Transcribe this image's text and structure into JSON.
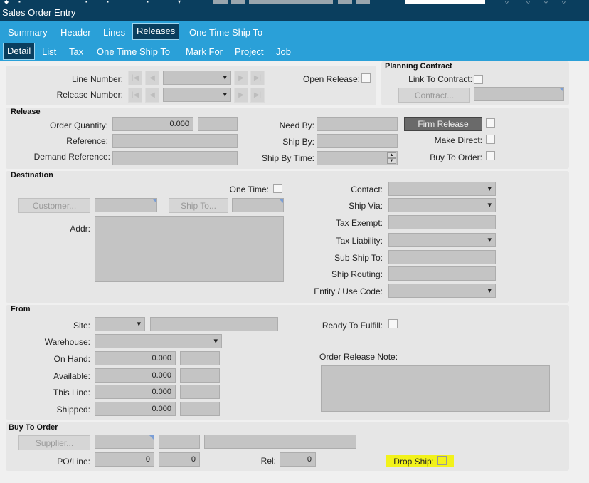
{
  "window": {
    "title": "Sales Order Entry"
  },
  "tabs_main": [
    "Summary",
    "Header",
    "Lines",
    "Releases",
    "One Time Ship To"
  ],
  "tabs_sub": [
    "Detail",
    "List",
    "Tax",
    "One Time Ship To",
    "Mark For",
    "Project",
    "Job"
  ],
  "top": {
    "line_number_label": "Line Number:",
    "release_number_label": "Release Number:",
    "open_release_label": "Open Release:",
    "planning_contract_title": "Planning Contract",
    "link_to_contract_label": "Link To Contract:",
    "contract_button": "Contract..."
  },
  "release": {
    "title": "Release",
    "order_quantity_label": "Order Quantity:",
    "order_quantity_value": "0.000",
    "reference_label": "Reference:",
    "demand_reference_label": "Demand Reference:",
    "need_by_label": "Need By:",
    "ship_by_label": "Ship By:",
    "ship_by_time_label": "Ship By Time:",
    "firm_release_button": "Firm Release",
    "make_direct_label": "Make Direct:",
    "buy_to_order_label": "Buy To Order:"
  },
  "destination": {
    "title": "Destination",
    "one_time_label": "One Time:",
    "customer_button": "Customer...",
    "ship_to_button": "Ship To...",
    "addr_label": "Addr:",
    "contact_label": "Contact:",
    "ship_via_label": "Ship Via:",
    "tax_exempt_label": "Tax Exempt:",
    "tax_liability_label": "Tax Liability:",
    "sub_ship_to_label": "Sub Ship To:",
    "ship_routing_label": "Ship Routing:",
    "entity_use_code_label": "Entity / Use Code:"
  },
  "from": {
    "title": "From",
    "site_label": "Site:",
    "warehouse_label": "Warehouse:",
    "on_hand_label": "On Hand:",
    "on_hand_value": "0.000",
    "available_label": "Available:",
    "available_value": "0.000",
    "this_line_label": "This Line:",
    "this_line_value": "0.000",
    "shipped_label": "Shipped:",
    "shipped_value": "0.000",
    "ready_to_fulfill_label": "Ready To Fulfill:",
    "order_release_note_label": "Order Release Note:"
  },
  "buy_to_order": {
    "title": "Buy To Order",
    "supplier_button": "Supplier...",
    "po_line_label": "PO/Line:",
    "po_value": "0",
    "line_value": "0",
    "rel_label": "Rel:",
    "rel_value": "0",
    "drop_ship_label": "Drop Ship:",
    "highlight_color": "#f2f21a"
  },
  "colors": {
    "titlebar": "#0a3e5e",
    "tabbar": "#2aa0d8",
    "active_tab": "#0a3e5e"
  }
}
